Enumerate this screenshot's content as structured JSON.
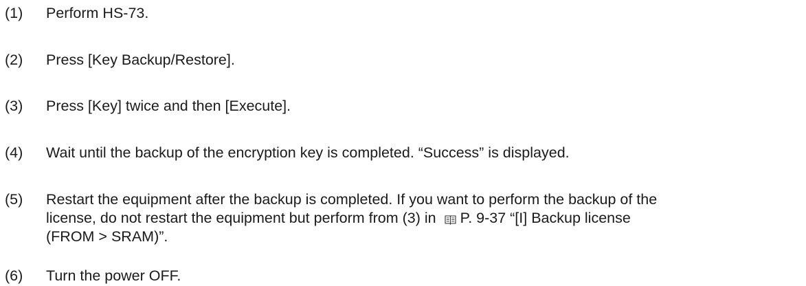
{
  "steps": [
    {
      "number": "(1)",
      "text": "Perform HS-73."
    },
    {
      "number": "(2)",
      "text": "Press [Key Backup/Restore]."
    },
    {
      "number": "(3)",
      "text": "Press [Key] twice and then [Execute]."
    },
    {
      "number": "(4)",
      "text": "Wait until the backup of the encryption key is completed. “Success” is displayed."
    },
    {
      "number": "(5)",
      "line1": "Restart the equipment after the backup is completed. If you want to perform the backup of the",
      "line2_before_icon": "license, do not restart the equipment but perform from (3) in",
      "icon": "book-icon",
      "line2_after_icon": "P. 9-37 “[I] Backup license",
      "line3": "(FROM > SRAM)”."
    },
    {
      "number": "(6)",
      "text": "Turn the power OFF."
    }
  ]
}
